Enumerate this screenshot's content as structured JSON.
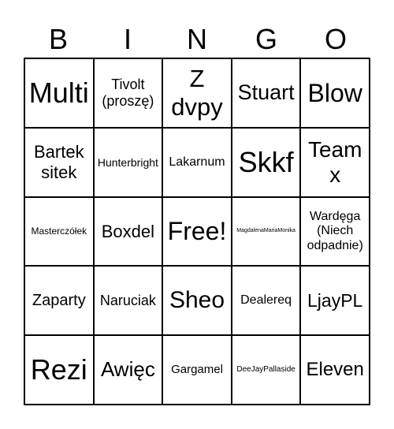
{
  "header": [
    "B",
    "I",
    "N",
    "G",
    "O"
  ],
  "cells": [
    "Multi",
    "Tivolt (proszę)",
    "Z dvpy",
    "Stuart",
    "Blow",
    "Bartek sitek",
    "Hunterbright",
    "Lakarnum",
    "Skkf",
    "Team x",
    "Masterczółek",
    "Boxdel",
    "Free!",
    "MagdalenaMariaMonika",
    "Wardęga (Niech odpadnie)",
    "Zaparty",
    "Naruciak",
    "Sheo",
    "Dealereq",
    "LjayPL",
    "Rezi",
    "Awięc",
    "Gargamel",
    "DeeJayPallaside",
    "Eleven"
  ]
}
